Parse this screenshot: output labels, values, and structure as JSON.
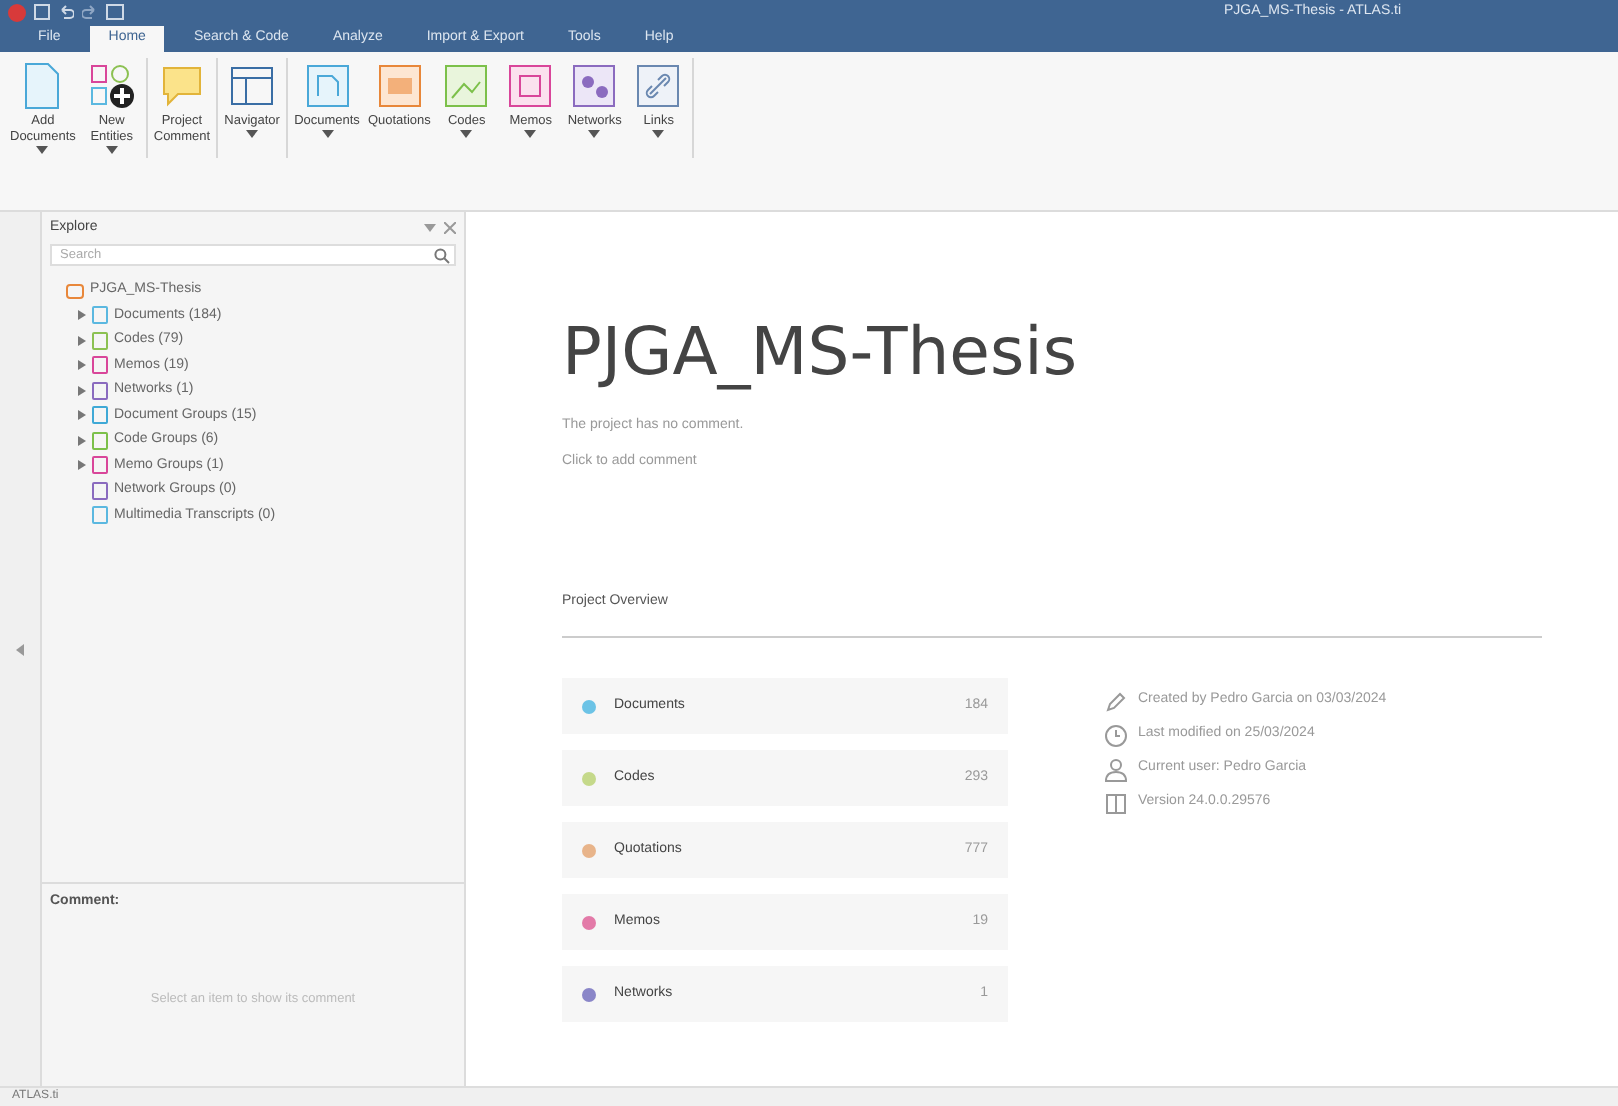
{
  "window": {
    "title": "PJGA_MS-Thesis - ATLAS.ti"
  },
  "menu_tabs": [
    {
      "label": "File",
      "selected": false
    },
    {
      "label": "Home",
      "selected": true
    },
    {
      "label": "Search & Code",
      "selected": false
    },
    {
      "label": "Analyze",
      "selected": false
    },
    {
      "label": "Import & Export",
      "selected": false
    },
    {
      "label": "Tools",
      "selected": false
    },
    {
      "label": "Help",
      "selected": false
    }
  ],
  "ribbon_groups": [
    [
      {
        "lines": [
          "Add",
          "Documents"
        ],
        "dropdown": true
      },
      {
        "lines": [
          "New",
          "Entities"
        ],
        "dropdown": true
      }
    ],
    [
      {
        "lines": [
          "Project",
          "Comment"
        ],
        "dropdown": false
      }
    ],
    [
      {
        "lines": [
          "Navigator"
        ],
        "dropdown": true
      }
    ],
    [
      {
        "lines": [
          "Documents"
        ],
        "dropdown": true
      },
      {
        "lines": [
          "Quotations"
        ],
        "dropdown": false
      },
      {
        "lines": [
          "Codes"
        ],
        "dropdown": true
      },
      {
        "lines": [
          "Memos"
        ],
        "dropdown": true
      },
      {
        "lines": [
          "Networks"
        ],
        "dropdown": true
      },
      {
        "lines": [
          "Links"
        ],
        "dropdown": true
      }
    ]
  ],
  "explorer": {
    "title": "Explore",
    "search": {
      "placeholder": "Search"
    },
    "tree": {
      "label": "PJGA_MS-Thesis",
      "children": [
        {
          "label": "Documents (184)",
          "color": "#5bb8e0",
          "expandable": true
        },
        {
          "label": "Codes (79)",
          "color": "#8cc152",
          "expandable": true
        },
        {
          "label": "Memos (19)",
          "color": "#d9469a",
          "expandable": true
        },
        {
          "label": "Networks (1)",
          "color": "#8b6bbf",
          "expandable": true
        },
        {
          "label": "Document Groups (15)",
          "color": "#3fa9d6",
          "expandable": true
        },
        {
          "label": "Code Groups (6)",
          "color": "#7cc04a",
          "expandable": true
        },
        {
          "label": "Memo Groups (1)",
          "color": "#d9469a",
          "expandable": true
        },
        {
          "label": "Network Groups (0)",
          "color": "#8b6bbf",
          "expandable": false
        },
        {
          "label": "Multimedia Transcripts (0)",
          "color": "#5bb8e0",
          "expandable": false
        }
      ]
    }
  },
  "comment_pane": {
    "title": "Comment:",
    "placeholder": "Select an item to show its comment"
  },
  "project": {
    "title": "PJGA_MS-Thesis",
    "comment_lines": [
      "The project has no comment.",
      "Click to add comment"
    ],
    "overview_heading": "Project Overview",
    "overview": [
      {
        "label": "Documents",
        "count": "184",
        "color": "#6cc3e6"
      },
      {
        "label": "Codes",
        "count": "293",
        "color": "#c5d98a"
      },
      {
        "label": "Quotations",
        "count": "777",
        "color": "#e8b48a"
      },
      {
        "label": "Memos",
        "count": "19",
        "color": "#e37aa8"
      },
      {
        "label": "Networks",
        "count": "1",
        "color": "#8a86c8"
      }
    ],
    "info": [
      "Created by Pedro Garcia on 03/03/2024",
      "Last modified on 25/03/2024",
      "Current user: Pedro Garcia",
      "Version 24.0.0.29576"
    ]
  },
  "status_bar": {
    "text": "ATLAS.ti"
  }
}
